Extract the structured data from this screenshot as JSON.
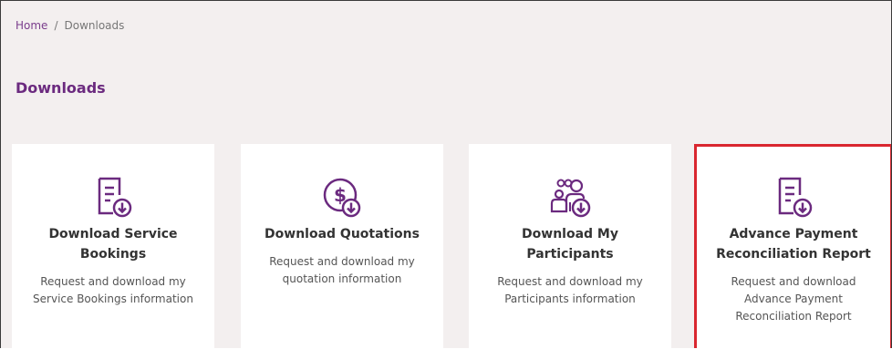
{
  "breadcrumb": {
    "home": "Home",
    "separator": "/",
    "current": "Downloads"
  },
  "page_title": "Downloads",
  "cards": [
    {
      "title_line1": "Download Service",
      "title_line2": "Bookings",
      "desc_line1": "Request and download my",
      "desc_line2": "Service Bookings information",
      "desc_line3": "",
      "icon": "document-download-icon"
    },
    {
      "title_line1": "Download Quotations",
      "title_line2": "",
      "desc_line1": "Request and download my",
      "desc_line2": "quotation information",
      "desc_line3": "",
      "icon": "dollar-download-icon"
    },
    {
      "title_line1": "Download My",
      "title_line2": "Participants",
      "desc_line1": "Request and download my",
      "desc_line2": "Participants information",
      "desc_line3": "",
      "icon": "participants-download-icon"
    },
    {
      "title_line1": "Advance Payment",
      "title_line2": "Reconciliation Report",
      "desc_line1": "Request and download",
      "desc_line2": "Advance Payment",
      "desc_line3": "Reconciliation Report",
      "icon": "document-download-icon"
    }
  ],
  "colors": {
    "accent": "#6b2a7f",
    "highlight_border": "#d9262f",
    "background": "#f3efef"
  }
}
